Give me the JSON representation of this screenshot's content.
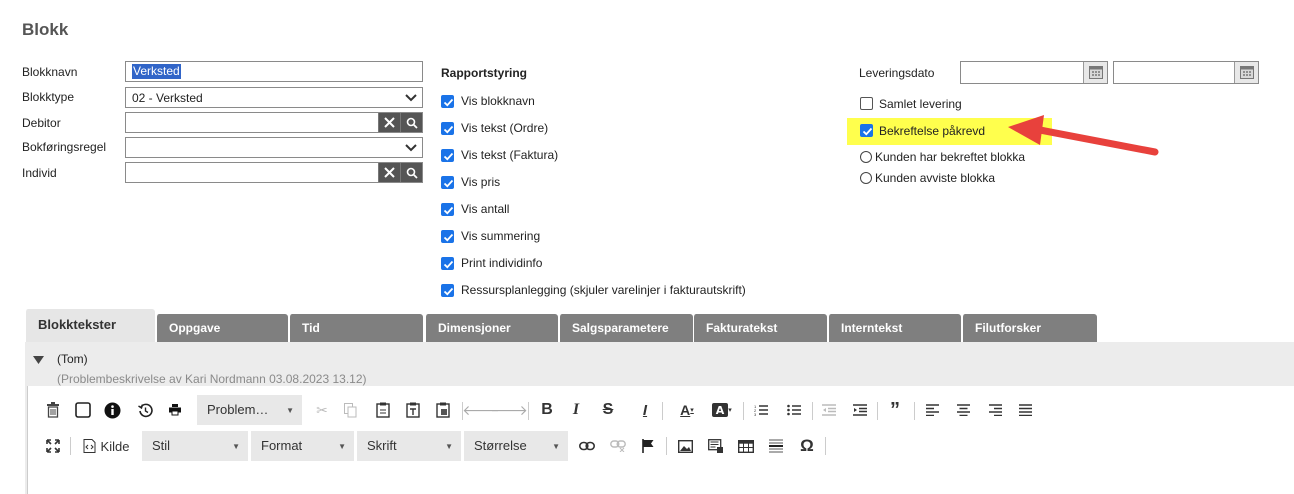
{
  "page": {
    "title": "Blokk"
  },
  "form": {
    "blokknavn_label": "Blokknavn",
    "blokknavn_value": "Verksted",
    "blokktype_label": "Blokktype",
    "blokktype_value": "02 - Verksted",
    "debitor_label": "Debitor",
    "debitor_value": "",
    "bokforingsregel_label": "Bokføringsregel",
    "bokforingsregel_value": "",
    "individ_label": "Individ",
    "individ_value": ""
  },
  "rapport": {
    "title": "Rapportstyring",
    "items": [
      {
        "label": "Vis blokknavn",
        "checked": true
      },
      {
        "label": "Vis tekst (Ordre)",
        "checked": true
      },
      {
        "label": "Vis tekst (Faktura)",
        "checked": true
      },
      {
        "label": "Vis pris",
        "checked": true
      },
      {
        "label": "Vis antall",
        "checked": true
      },
      {
        "label": "Vis summering",
        "checked": true
      },
      {
        "label": "Print individinfo",
        "checked": true
      },
      {
        "label": "Ressursplanlegging (skjuler varelinjer i fakturautskrift)",
        "checked": true
      }
    ]
  },
  "levering": {
    "leveringsdato_label": "Leveringsdato",
    "from_value": "",
    "to_value": "",
    "samlet_label": "Samlet levering",
    "samlet_checked": false,
    "bekreftelse_label": "Bekreftelse påkrevd",
    "bekreftelse_checked": true,
    "radio_bekreftet": "Kunden har bekreftet blokka",
    "radio_avviste": "Kunden avviste blokka",
    "highlight_color": "#ffff4d",
    "arrow_color": "#e8413c"
  },
  "tabs": [
    {
      "label": "Blokktekster",
      "active": true
    },
    {
      "label": "Oppgave",
      "active": false
    },
    {
      "label": "Tid",
      "active": false
    },
    {
      "label": "Dimensjoner",
      "active": false
    },
    {
      "label": "Salgsparametere",
      "active": false
    },
    {
      "label": "Fakturatekst",
      "active": false
    },
    {
      "label": "Interntekst",
      "active": false
    },
    {
      "label": "Filutforsker",
      "active": false
    }
  ],
  "editor": {
    "entry_title": "(Tom)",
    "entry_subtitle": "(Problembeskrivelse av Kari Nordmann 03.08.2023 13.12)",
    "problem_dropdown": "Problem…",
    "kilde_label": "Kilde",
    "stil_label": "Stil",
    "format_label": "Format",
    "skrift_label": "Skrift",
    "storrelse_label": "Størrelse"
  }
}
